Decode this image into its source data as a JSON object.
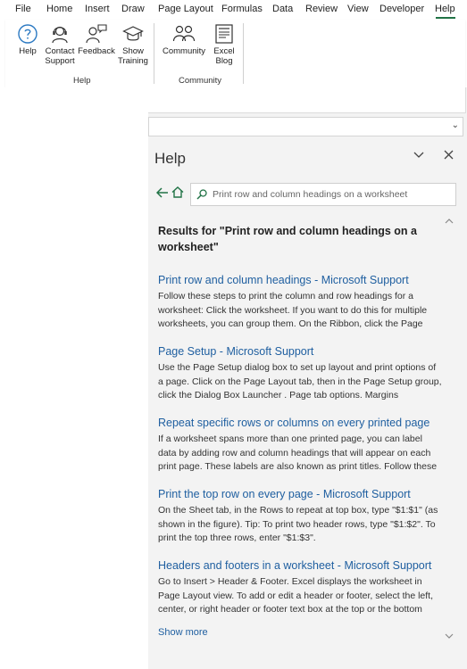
{
  "menubar": {
    "tabs": [
      "File",
      "Home",
      "Insert",
      "Draw",
      "Page Layout",
      "Formulas",
      "Data",
      "Review",
      "View",
      "Developer",
      "Help"
    ],
    "active_tab": "Help",
    "accent_color": "#217346"
  },
  "ribbon": {
    "help_group": {
      "label": "Help",
      "buttons": [
        {
          "label_line1": "Help",
          "label_line2": "",
          "icon": "help-question-icon"
        },
        {
          "label_line1": "Contact",
          "label_line2": "Support",
          "icon": "headset-icon"
        },
        {
          "label_line1": "Feedback",
          "label_line2": "",
          "icon": "feedback-person-icon"
        },
        {
          "label_line1": "Show",
          "label_line2": "Training",
          "icon": "graduation-cap-icon"
        }
      ]
    },
    "community_group": {
      "label": "Community",
      "buttons": [
        {
          "label_line1": "Community",
          "label_line2": "",
          "icon": "community-people-icon"
        },
        {
          "label_line1": "Excel",
          "label_line2": "Blog",
          "icon": "blog-document-icon"
        }
      ]
    }
  },
  "help_pane": {
    "title": "Help",
    "search": {
      "value": "Print row and column headings on a worksheet",
      "placeholder": ""
    },
    "results_heading": "Results for \"Print row and column headings on a worksheet\"",
    "results": [
      {
        "title": "Print row and column headings - Microsoft Support",
        "snippet": "Follow these steps to print the column and row headings for a worksheet: Click the worksheet. If you want to do this for multiple worksheets, you can group them. On the Ribbon, click the Page"
      },
      {
        "title": "Page Setup - Microsoft Support",
        "snippet": "Use the Page Setup dialog box to set up layout and print options of a page. Click on the Page Layout tab, then in the Page Setup group, click the Dialog Box Launcher . Page tab options. Margins"
      },
      {
        "title": "Repeat specific rows or columns on every printed page",
        "snippet": "If a worksheet spans more than one printed page, you can label data by adding row and column headings that will appear on each print page. These labels are also known as print titles. Follow these"
      },
      {
        "title": "Print the top row on every page - Microsoft Support",
        "snippet": "On the Sheet tab, in the Rows to repeat at top box, type \"$1:$1\" (as shown in the figure). Tip: To print two header rows, type \"$1:$2\". To print the top three rows, enter \"$1:$3\"."
      },
      {
        "title": "Headers and footers in a worksheet - Microsoft Support",
        "snippet": "Go to Insert > Header & Footer. Excel displays the worksheet in Page Layout view. To add or edit a header or footer, select the left, center, or right header or footer text box at the top or the bottom"
      }
    ],
    "show_more": "Show more",
    "link_color": "#1f5fa0"
  }
}
